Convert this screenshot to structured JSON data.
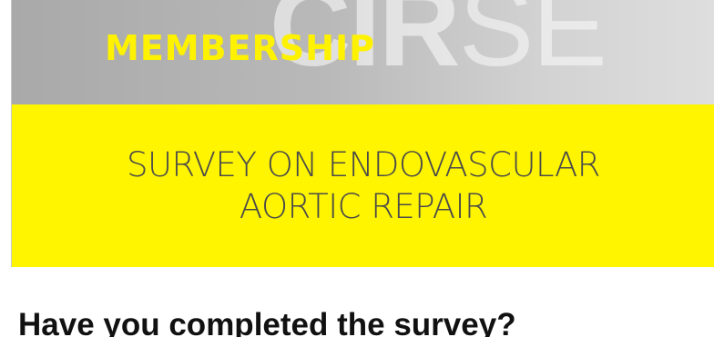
{
  "header": {
    "logo": {
      "part_bold": "CIR",
      "part_light": "SE"
    },
    "section_label": "MEMBERSHIP"
  },
  "banner": {
    "title_line1": "SURVEY ON ENDOVASCULAR",
    "title_line2": "AORTIC REPAIR"
  },
  "content": {
    "question": "Have you completed the survey?"
  },
  "colors": {
    "accent_yellow": "#fff500",
    "label_yellow": "#fff200",
    "banner_grey": "#b9b9b9",
    "title_text": "#4a4a4a"
  }
}
